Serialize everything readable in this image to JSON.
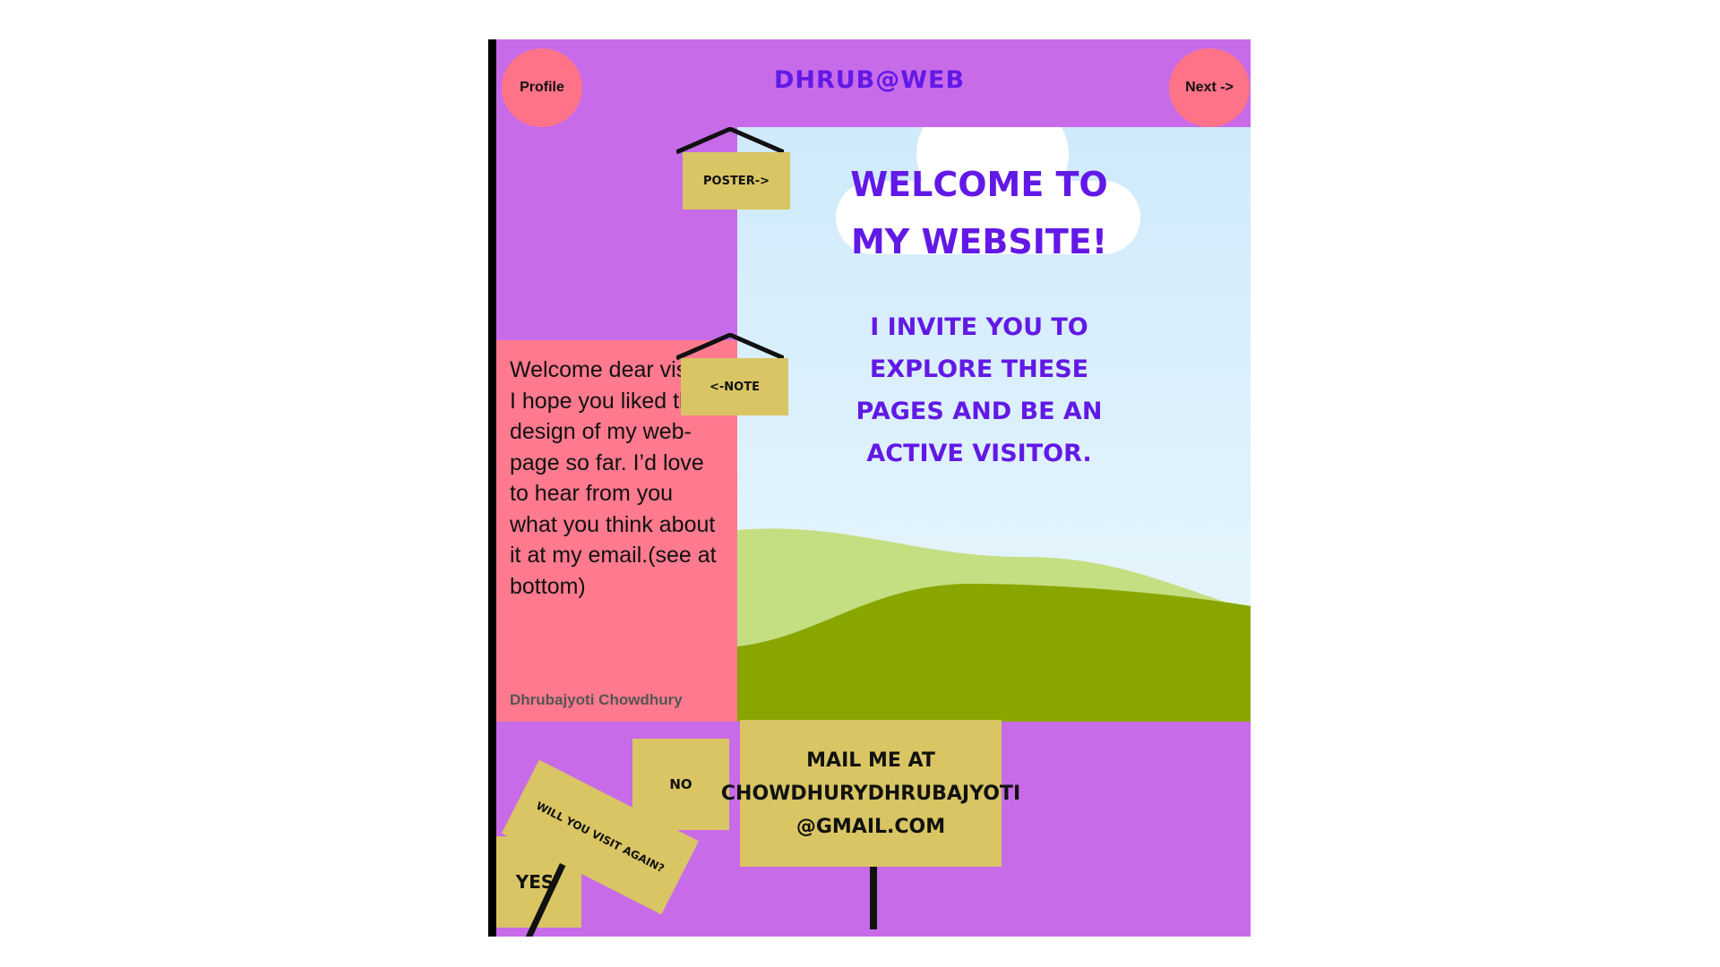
{
  "header": {
    "title": "DHRUB@WEB",
    "profile_label": "Profile",
    "next_label": "Next ->"
  },
  "hero": {
    "welcome": "WELCOME TO MY WEBSITE!",
    "invite": "I INVITE YOU TO EXPLORE THESE PAGES AND BE AN ACTIVE VISITOR."
  },
  "signs": {
    "poster": "POSTER->",
    "note": "<-NOTE",
    "visit_question": "WILL YOU VISIT AGAIN?",
    "yes": "YES",
    "no": "NO",
    "mail_line1": "MAIL ME AT",
    "mail_line2": "CHOWDHURYDHRUBAJYOTI",
    "mail_line3": "@GMAIL.COM"
  },
  "note": {
    "text": "Welcome dear visitor! I hope you liked the design of my web-page so far. I’d love to hear from you what you think about it at my email.(see at bottom)",
    "author": "Dhrubajyoti Chowdhury"
  },
  "colors": {
    "background": "#c86be9",
    "accent_text": "#6219e6",
    "pink": "#ff7a8e",
    "sign": "#d9c563",
    "hill_dark": "#89a600",
    "hill_light": "#c4de82"
  }
}
